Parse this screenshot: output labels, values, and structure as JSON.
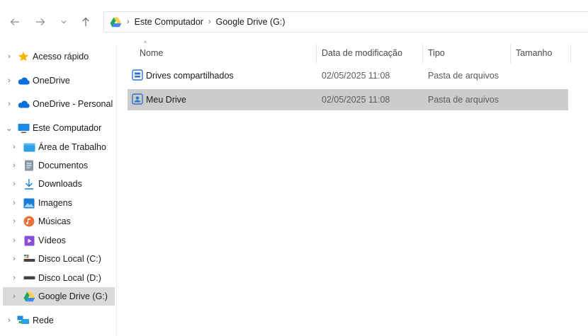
{
  "nav": {
    "back_icon": "arrow-left-icon",
    "forward_icon": "arrow-right-icon",
    "recent_icon": "chevron-down-icon",
    "up_icon": "arrow-up-icon"
  },
  "address": {
    "crumbs": [
      "Este Computador",
      "Google Drive (G:)"
    ]
  },
  "sidebar": {
    "items": [
      {
        "label": "Acesso rápido",
        "icon": "star-icon"
      },
      {
        "label": "OneDrive",
        "icon": "cloud-icon"
      },
      {
        "label": "OneDrive - Personal",
        "icon": "cloud-icon"
      },
      {
        "label": "Este Computador",
        "icon": "computer-icon"
      },
      {
        "label": "Área de Trabalho",
        "icon": "desktop-icon"
      },
      {
        "label": "Documentos",
        "icon": "document-icon"
      },
      {
        "label": "Downloads",
        "icon": "download-icon"
      },
      {
        "label": "Imagens",
        "icon": "images-icon"
      },
      {
        "label": "Músicas",
        "icon": "music-icon"
      },
      {
        "label": "Vídeos",
        "icon": "video-icon"
      },
      {
        "label": "Disco Local (C:)",
        "icon": "drive-icon"
      },
      {
        "label": "Disco Local (D:)",
        "icon": "drive-icon"
      },
      {
        "label": "Google Drive (G:)",
        "icon": "google-drive-icon"
      },
      {
        "label": "Rede",
        "icon": "network-icon"
      }
    ],
    "selected": "Google Drive (G:)"
  },
  "list": {
    "columns": [
      "Nome",
      "Data de modificação",
      "Tipo",
      "Tamanho"
    ],
    "rows": [
      {
        "name": "Drives compartilhados",
        "date": "02/05/2025 11:08",
        "type": "Pasta de arquivos",
        "size": ""
      },
      {
        "name": "Meu Drive",
        "date": "02/05/2025 11:08",
        "type": "Pasta de arquivos",
        "size": ""
      }
    ],
    "selected_row": "Meu Drive"
  },
  "colors": {
    "selection": "#cccccc",
    "sidebar_selection": "#dadada",
    "accent": "#0067c0",
    "gdrive_green": "#1fa463",
    "gdrive_yellow": "#ffd04b",
    "gdrive_blue": "#4688f4"
  }
}
